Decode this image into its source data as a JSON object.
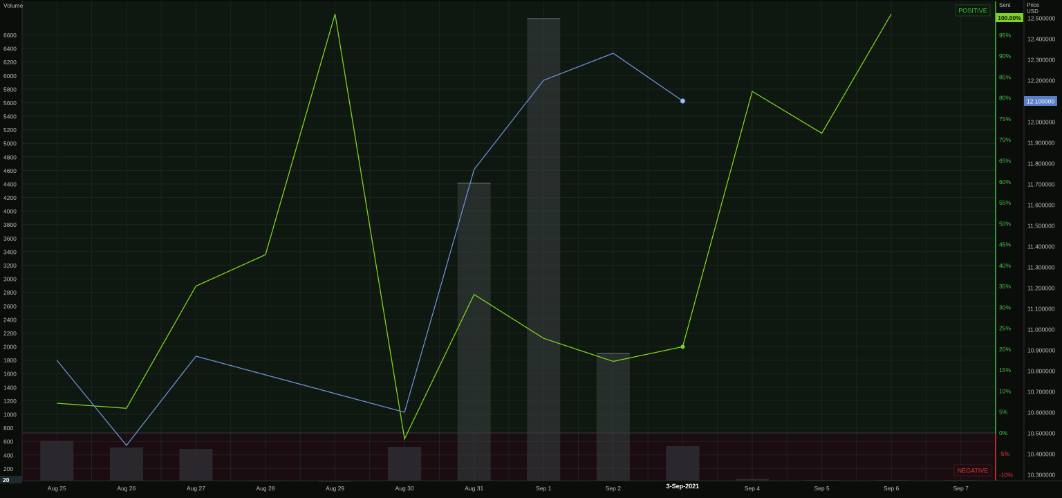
{
  "axes": {
    "volume_label": "Volume",
    "sent_label": "Sent",
    "price_label_line1": "Price",
    "price_label_line2": "USD",
    "positive_label": "POSITIVE",
    "negative_label": "NEGATIVE",
    "volume_badge": "20",
    "sent_badge": "100.00%",
    "price_badge": "12.100000",
    "crosshair_date": "3-Sep-2021"
  },
  "colors": {
    "background": "#0b0d0b",
    "positive_zone": "#0e1810",
    "negative_zone": "#1a0c10",
    "grid": "#1c261c",
    "sentiment": "#7ed321",
    "price": "#6d8fd8",
    "volume_dark": "#2e2b31",
    "volume_light": "#3a3f42",
    "negative_text": "#e03a3a",
    "positive_text": "#44c044"
  },
  "chart_data": {
    "type": "line",
    "categories": [
      "Aug 25",
      "Aug 26",
      "Aug 27",
      "Aug 28",
      "Aug 29",
      "Aug 30",
      "Aug 31",
      "Sep 1",
      "Sep 2",
      "Sep 3",
      "Sep 4",
      "Sep 5",
      "Sep 6",
      "Sep 7"
    ],
    "volume_ticks": [
      200,
      400,
      600,
      800,
      1000,
      1200,
      1400,
      1600,
      1800,
      2000,
      2200,
      2400,
      2600,
      2800,
      3000,
      3200,
      3400,
      3600,
      3800,
      4000,
      4200,
      4400,
      4600,
      4800,
      5000,
      5200,
      5400,
      5600,
      5800,
      6000,
      6200,
      6400,
      6600
    ],
    "sent_ticks": [
      "-10%",
      "-5%",
      "0%",
      "5%",
      "10%",
      "15%",
      "20%",
      "25%",
      "30%",
      "35%",
      "40%",
      "45%",
      "50%",
      "55%",
      "60%",
      "65%",
      "70%",
      "75%",
      "80%",
      "85%",
      "90%",
      "95%"
    ],
    "price_ticks": [
      "10.300000",
      "10.400000",
      "10.500000",
      "10.600000",
      "10.700000",
      "10.800000",
      "10.900000",
      "11.000000",
      "11.100000",
      "11.200000",
      "11.300000",
      "11.400000",
      "11.500000",
      "11.600000",
      "11.700000",
      "11.800000",
      "11.900000",
      "12.000000",
      "12.100000",
      "12.200000",
      "12.300000",
      "12.400000",
      "12.500000"
    ],
    "volume_range": [
      20,
      6850
    ],
    "sent_range": [
      -11.5,
      103
    ],
    "price_range": [
      10.27,
      12.58
    ],
    "series": [
      {
        "name": "Volume",
        "type": "bar",
        "values": [
          610,
          510,
          490,
          20,
          10,
          520,
          4410,
          6840,
          1900,
          530,
          50,
          30,
          30,
          30
        ]
      },
      {
        "name": "Sent",
        "type": "line",
        "values": [
          7,
          5.8,
          35,
          42.5,
          100,
          -1.5,
          33,
          22.5,
          17,
          20.5,
          81.5,
          71.5,
          100,
          null
        ]
      },
      {
        "name": "Price",
        "type": "line",
        "values": [
          10.85,
          10.44,
          10.87,
          null,
          null,
          10.6,
          11.77,
          12.2,
          12.33,
          12.1,
          null,
          null,
          null,
          null
        ]
      }
    ],
    "grid": true
  }
}
